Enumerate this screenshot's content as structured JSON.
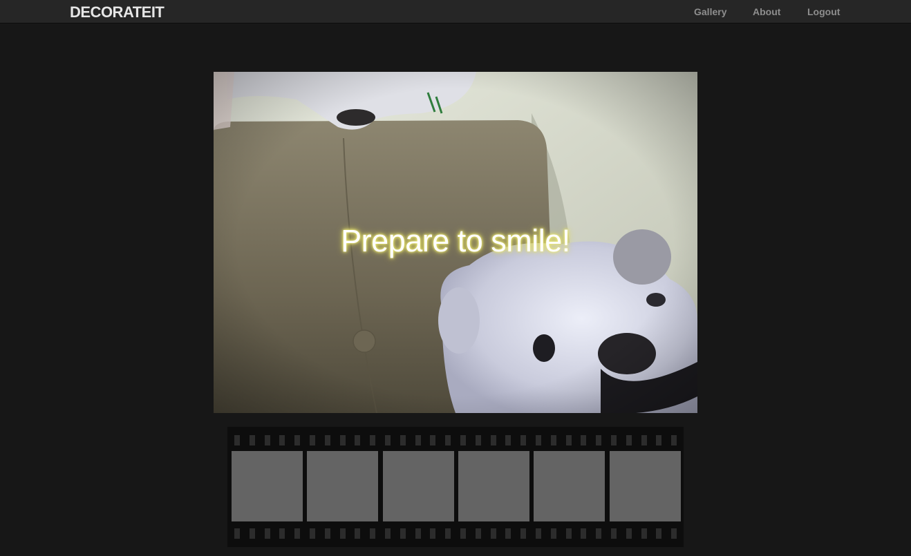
{
  "navbar": {
    "brand": "DECORATEIT",
    "links": [
      {
        "label": "Gallery"
      },
      {
        "label": "About"
      },
      {
        "label": "Logout"
      }
    ]
  },
  "camera": {
    "overlay_text": "Prepare to smile!"
  },
  "filmstrip": {
    "frame_count": 6,
    "frames": [
      "",
      "",
      "",
      "",
      "",
      ""
    ]
  },
  "colors": {
    "background": "#171717",
    "navbar": "#262626",
    "brand_text": "#e6e6e6",
    "nav_link_text": "#8e8e8e",
    "film_frame": "#646464",
    "overlay_glow": "#f2f07a"
  }
}
